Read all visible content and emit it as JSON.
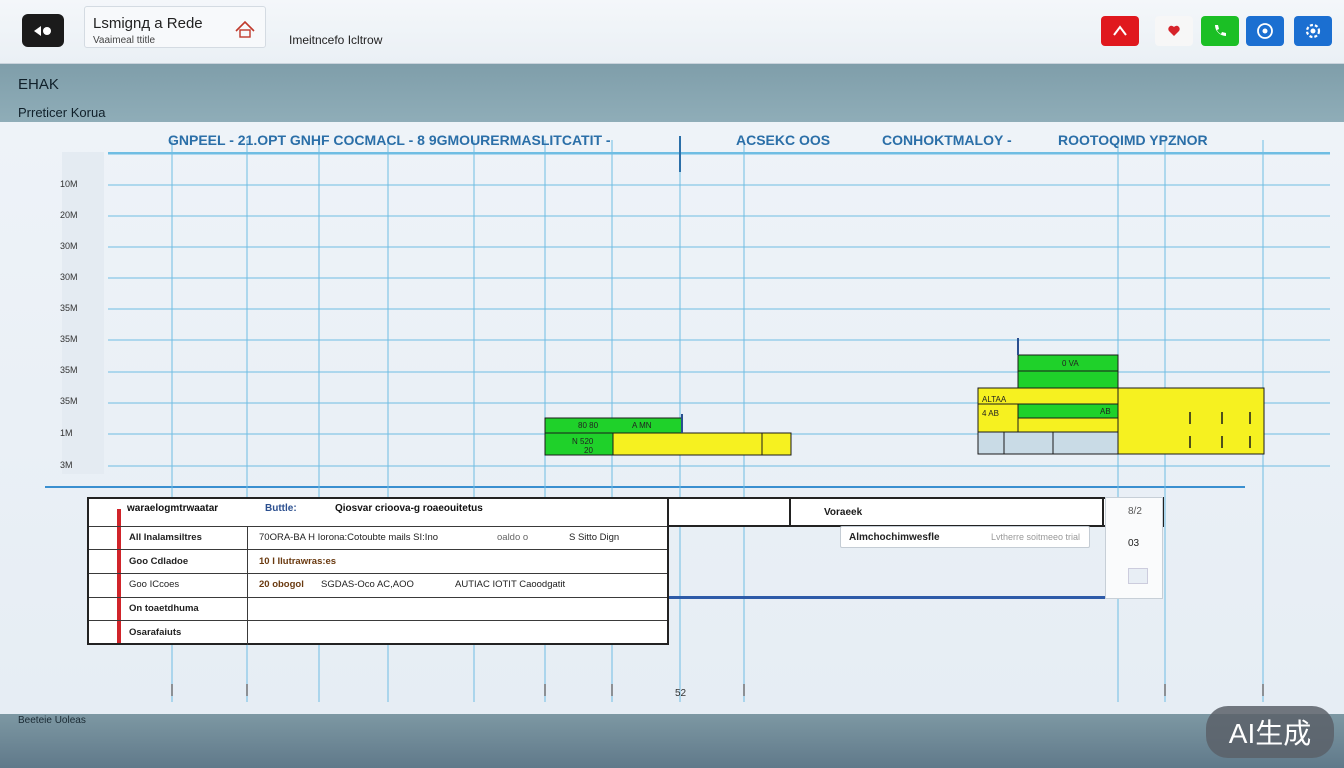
{
  "topbar": {
    "tab_title": "Lsmignд a Rede",
    "tab_subtitle": "Vaaimeal ttitle",
    "info_text": "Imeitncefo Icltrow",
    "icons": [
      "app-logo-icon",
      "home-icon",
      "red-alert-button",
      "heart-flag-icon",
      "green-phone-button",
      "blue-network-button",
      "blue-gear-button"
    ]
  },
  "header_band": {
    "title": "EHAK",
    "subtitle": "Prreticer Korua"
  },
  "chart": {
    "col_headers": [
      "GNPEEL - 21.OPT GNHF COCMACL - 8 9GMOURERMASLITCATIT -",
      "ACSEKC OOS",
      "CONHOKTMALOY -",
      "ROOTOQIMD YPZNOR"
    ],
    "y_ticks": [
      "10M",
      "20M",
      "30M",
      "30M",
      "35M",
      "35M",
      "35M",
      "35M",
      "1M",
      "3M"
    ],
    "x_tick_mid": "52",
    "bar_group_1_labels": [
      "80 80",
      "A MN",
      "N 520",
      "20"
    ],
    "bar_group_2_labels": [
      "0 VA",
      "ALTAA",
      "4 AB",
      "AB"
    ]
  },
  "table": {
    "headers": [
      "waraelogmtrwaatar",
      "Buttle:",
      "Qiosvar crioova-g roaeouitetus",
      "Voraeek"
    ],
    "rows": [
      {
        "label": "All Inalamsiltres",
        "c1": "70ORA-BA H Iorona:Cotoubte mails SI:Ino",
        "c2": "oaldo o",
        "c3": "S Sitto Dign"
      },
      {
        "label": "Goo Cdladoe",
        "c1": "10 I Ilutrawras:es",
        "c2": "",
        "c3": ""
      },
      {
        "label": "Goo ICcoes",
        "c1": "20 obogol",
        "c2": "SGDAS-Oco AC,AOO",
        "c3": "AUTIAC IOTIT Caoodgatit"
      },
      {
        "label": "On toaetdhuma",
        "c1": "",
        "c2": "",
        "c3": ""
      },
      {
        "label": "Osarafaiuts",
        "c1": "",
        "c2": "",
        "c3": ""
      }
    ],
    "search_value": "Almchochimwesfle",
    "search_placeholder": "Lvtherre soitmeeo trial",
    "side_label": "03",
    "side_pager": "8/2"
  },
  "footer": {
    "status_text": "Beeteie Uoleas",
    "badge": "AI生成"
  },
  "colors": {
    "grid": "#6fbde3",
    "bar_green": "#1fd12a",
    "bar_yellow": "#f6f120",
    "accent_red": "#d0242a",
    "btn_red": "#e0181e",
    "btn_green": "#1bbf25",
    "btn_blue": "#1b6fd1"
  }
}
